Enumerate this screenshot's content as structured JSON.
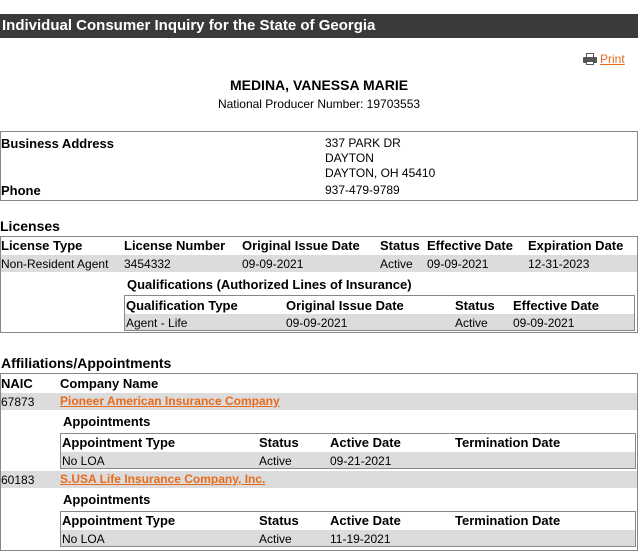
{
  "page_title": "Individual Consumer Inquiry for the State of Georgia",
  "print_label": "Print",
  "producer": {
    "name": "MEDINA, VANESSA MARIE",
    "npn": "National Producer Number: 19703553"
  },
  "contact": {
    "business_address_label": "Business Address",
    "address_lines": [
      "337 PARK DR",
      "DAYTON",
      "DAYTON, OH 45410"
    ],
    "phone_label": "Phone",
    "phone": "937-479-9789"
  },
  "licenses": {
    "heading": "Licenses",
    "columns": [
      "License Type",
      "License Number",
      "Original Issue Date",
      "Status",
      "Effective Date",
      "Expiration Date"
    ],
    "row": [
      "Non-Resident Agent",
      "3454332",
      "09-09-2021",
      "Active",
      "09-09-2021",
      "12-31-2023"
    ],
    "qualifications_heading": "Qualifications (Authorized Lines of Insurance)",
    "qual_columns": [
      "Qualification Type",
      "Original Issue Date",
      "Status",
      "Effective Date"
    ],
    "qual_row": [
      "Agent - Life",
      "09-09-2021",
      "Active",
      "09-09-2021"
    ]
  },
  "affiliations": {
    "heading": "Affiliations/Appointments",
    "columns": [
      "NAIC",
      "Company Name"
    ],
    "appointments_heading": "Appointments",
    "appt_columns": [
      "Appointment Type",
      "Status",
      "Active Date",
      "Termination Date"
    ],
    "companies": [
      {
        "naic": "67873",
        "name": "Pioneer American Insurance Company",
        "appt": [
          "No LOA",
          "Active",
          "09-21-2021",
          ""
        ]
      },
      {
        "naic": "60183",
        "name": "S.USA Life Insurance Company, Inc.",
        "appt": [
          "No LOA",
          "Active",
          "11-19-2021",
          ""
        ]
      }
    ]
  },
  "colors": {
    "title_bar": "#3a3a3a",
    "link": "#e86a1b",
    "row_shade": "#dcdcdc"
  }
}
